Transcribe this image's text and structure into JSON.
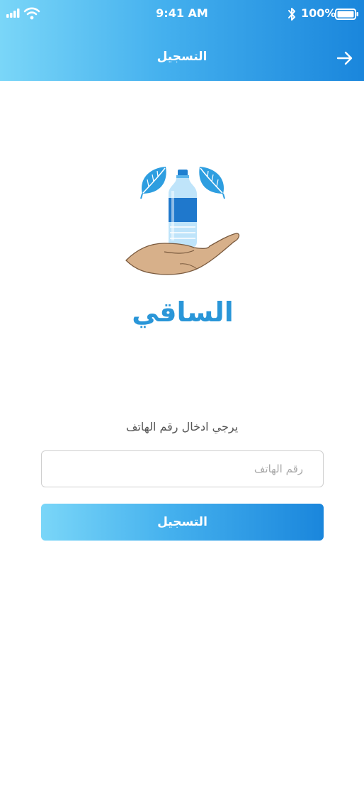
{
  "status_bar": {
    "time": "9:41 AM",
    "battery": "100%"
  },
  "nav": {
    "title": "التسجيل",
    "back_icon": "arrow-right-icon"
  },
  "logo": {
    "name": "الساقي"
  },
  "form": {
    "prompt": "يرجي ادخال رقم الهاتف",
    "phone_placeholder": "رقم الهاتف",
    "phone_value": "",
    "submit_label": "التسجيل"
  },
  "colors": {
    "gradient_start": "#7ad6f8",
    "gradient_end": "#1a86dc",
    "logo_text": "#2a96d8",
    "leaf": "#2e9ee0",
    "hand": "#d7b08a"
  }
}
